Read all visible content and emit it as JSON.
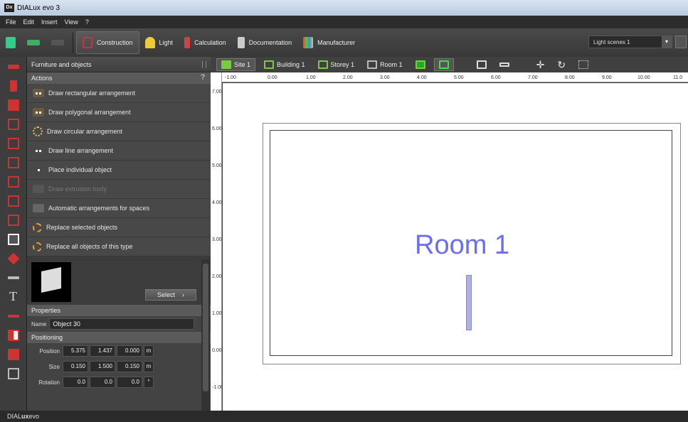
{
  "window": {
    "title": "DIALux evo 3",
    "app_icon": "Dx"
  },
  "menu": [
    "File",
    "Edit",
    "Insert",
    "View",
    "?"
  ],
  "toolbar": {
    "tabs": [
      {
        "label": "Construction",
        "active": true
      },
      {
        "label": "Light"
      },
      {
        "label": "Calculation"
      },
      {
        "label": "Documentation"
      },
      {
        "label": "Manufacturer"
      }
    ],
    "scene": "Light scenes 1"
  },
  "panel": {
    "title": "Furniture and objects",
    "actions_header": "Actions",
    "help": "?",
    "actions": [
      {
        "label": "Draw rectangular arrangement",
        "enabled": true
      },
      {
        "label": "Draw polygonal arrangement",
        "enabled": true
      },
      {
        "label": "Draw circular arrangement",
        "enabled": true
      },
      {
        "label": "Draw line arrangement",
        "enabled": true
      },
      {
        "label": "Place individual object",
        "enabled": true
      },
      {
        "label": "Draw extrusion body",
        "enabled": false
      },
      {
        "label": "Automatic arrangements for spaces",
        "enabled": true
      },
      {
        "label": "Replace selected objects",
        "enabled": true
      },
      {
        "label": "Replace all objects of this type",
        "enabled": true
      }
    ],
    "select_label": "Select",
    "properties_header": "Properties",
    "name_label": "Name",
    "name_value": "Object 30",
    "positioning_header": "Positioning",
    "position": {
      "label": "Position",
      "x": "5.375",
      "y": "1.437",
      "z": "0.000",
      "unit": "m"
    },
    "size": {
      "label": "Size",
      "x": "0.150",
      "y": "1.500",
      "z": "0.150",
      "unit": "m"
    },
    "rotation": {
      "label": "Rotation",
      "x": "0.0",
      "y": "0.0",
      "z": "0.0",
      "unit": "°"
    }
  },
  "viewbar": {
    "tabs": [
      "Site 1",
      "Building 1",
      "Storey 1",
      "Room 1"
    ]
  },
  "ruler": {
    "h_ticks": [
      "-1.00",
      "0.00",
      "1.00",
      "2.00",
      "3.00",
      "4.00",
      "5.00",
      "6.00",
      "7.00",
      "8.00",
      "9.00",
      "10.00",
      "11.0"
    ],
    "v_ticks": [
      "7.00",
      "6.00",
      "5.00",
      "4.00",
      "3.00",
      "2.00",
      "1.00",
      "0.00",
      "-1.00"
    ]
  },
  "canvas": {
    "room_label": "Room 1"
  },
  "status": {
    "brand_prefix": "DIAL",
    "brand_bold": "ux",
    "brand_suffix": "evo"
  }
}
